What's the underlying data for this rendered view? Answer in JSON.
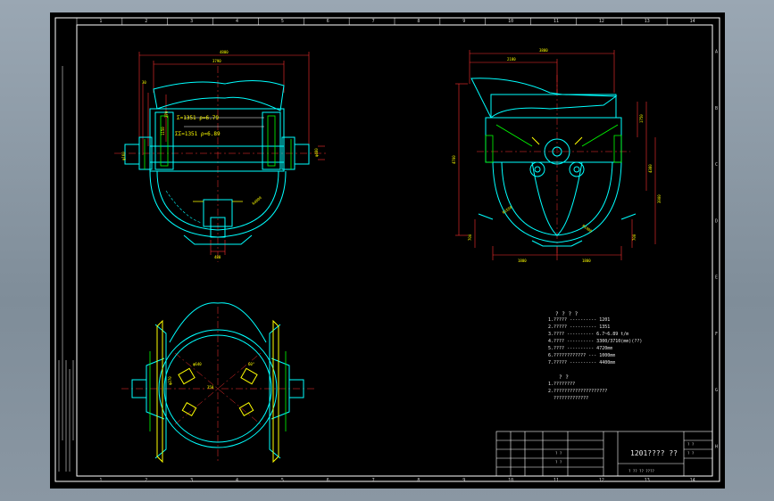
{
  "drawing": {
    "colors": {
      "frame": "#ffffff",
      "body": "#00ffff",
      "dim": "#ff3030",
      "dim_text": "#ffff00",
      "center": "#ff3030",
      "green": "#00ff00",
      "hatch": "#ffff00",
      "background": "#000000"
    },
    "zone_numbers_top": [
      "1",
      "2",
      "3",
      "4",
      "5",
      "6",
      "7",
      "8",
      "9",
      "10",
      "11",
      "12",
      "13",
      "14"
    ],
    "zone_numbers_side": [
      "A",
      "B",
      "C",
      "D",
      "E",
      "F",
      "G",
      "H"
    ],
    "front_view": {
      "dims_top": [
        "4800",
        "3790"
      ],
      "dims_left": [
        "30",
        "270",
        "1150"
      ],
      "labels": [
        "Σ=1351 ρ=6.79",
        "ΣΣ=1351 ρ=6.89"
      ],
      "dims_right": [
        "φ480",
        "φ160"
      ],
      "dims_bottom": [
        "480"
      ],
      "radius": "R4800"
    },
    "side_view": {
      "dims_top": [
        "3800",
        "2180"
      ],
      "dims_left": [
        "4700"
      ],
      "dims_right": [
        "1750",
        "4380",
        "3900"
      ],
      "dims_bottom": [
        "1800",
        "1800"
      ],
      "misc": [
        "R1550",
        "R1400",
        "700",
        "700"
      ]
    },
    "plan_view": {
      "dims": [
        "φ640",
        "350",
        "φ270",
        "60°"
      ]
    },
    "notes": {
      "title": "? ? ? ?",
      "lines": [
        "1.????? ---------- 1201",
        "2.????? ---------- 1351",
        "3.???? ---------- 6.7~6.89 t/m",
        "4.???? ---------- 3300/3710(mm)(??)",
        "5.???? ---------- 4720mm",
        "6.???????????? --- 1000mm",
        "7.????? ---------- 4400mm"
      ],
      "title2": "? ?",
      "lines2": [
        "1.????????",
        "2.????????????????????",
        "  ?????????????"
      ]
    },
    "title_block": {
      "title": "1201???? ??",
      "company": "? ?? ?? ????",
      "cells": [
        "? ?",
        "? ?",
        "? ?",
        "? ?"
      ]
    }
  }
}
